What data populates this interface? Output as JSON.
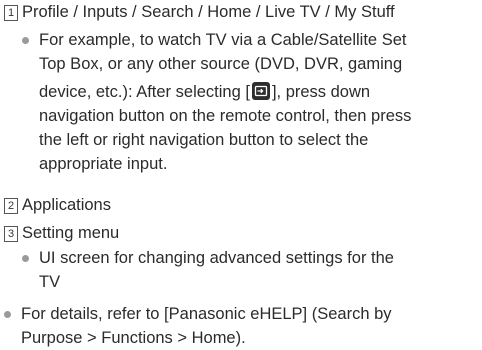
{
  "items": [
    {
      "number": "1",
      "label": "Profile / Inputs / Search / Home / Live TV / My Stuff"
    },
    {
      "number": "2",
      "label": "Applications"
    },
    {
      "number": "3",
      "label": "Setting menu"
    }
  ],
  "example_bullet": {
    "lines": [
      "For example, to watch TV via a Cable/Satellite Set",
      "Top Box, or any other source (DVD, DVR, gaming"
    ],
    "line3_before": "device, etc.): After selecting [",
    "line3_after": "], press down",
    "lines_after": [
      "navigation button on the remote control, then press",
      "the left or right navigation button to select the",
      "appropriate input."
    ]
  },
  "setting_bullet": {
    "lines": [
      "UI screen for changing advanced settings for the",
      "TV"
    ]
  },
  "details_bullet": {
    "lines": [
      "For details, refer to [Panasonic eHELP] (Search by",
      "Purpose > Functions > Home)."
    ]
  },
  "icons": {
    "inputs": "input-source-icon"
  }
}
